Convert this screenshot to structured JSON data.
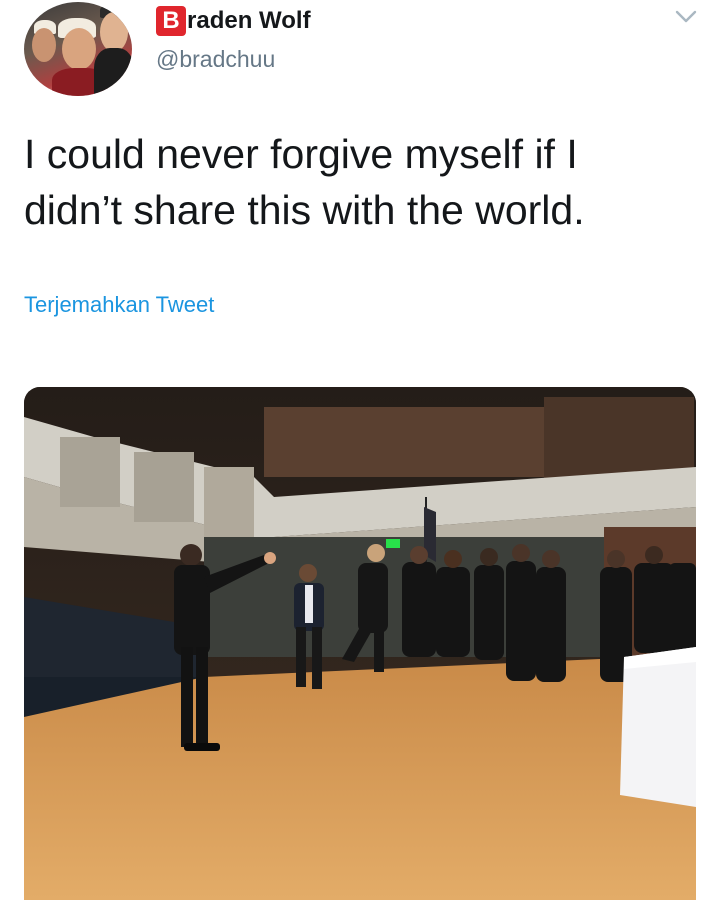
{
  "tweet": {
    "author": {
      "name_initial": "B",
      "name_rest": "raden Wolf",
      "handle": "@bradchuu"
    },
    "text_line1": "I could never forgive myself if I",
    "text_line2": "didn’t share this with the world.",
    "translate_label": "Terjemahkan Tweet"
  },
  "colors": {
    "link": "#1b95e0",
    "badge": "#e0262d",
    "secondary_text": "#657786"
  },
  "icons": {
    "menu": "chevron-down-icon"
  }
}
